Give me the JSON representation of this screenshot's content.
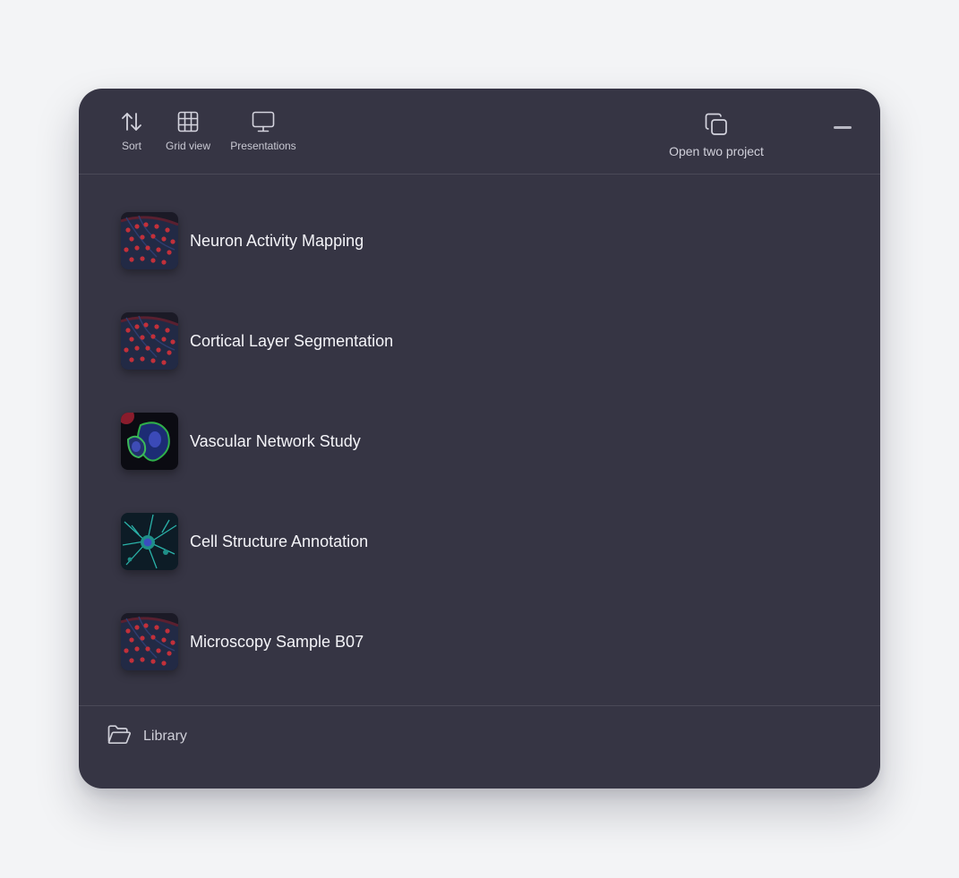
{
  "toolbar": {
    "sort": {
      "label": "Sort",
      "icon": "sort-arrows-icon"
    },
    "grid_view": {
      "label": "Grid view",
      "icon": "grid-icon"
    },
    "presentations": {
      "label": "Presentations",
      "icon": "monitor-icon"
    },
    "open_two": {
      "label": "Open two project",
      "icon": "copy-icon"
    },
    "minimize": {
      "icon": "minimize-icon"
    }
  },
  "projects": [
    {
      "name": "Neuron Activity Mapping",
      "thumbnail": "tissue-red-cells"
    },
    {
      "name": "Cortical Layer Segmentation",
      "thumbnail": "tissue-red-cells"
    },
    {
      "name": "Vascular Network Study",
      "thumbnail": "cells-blue-green"
    },
    {
      "name": "Cell Structure Annotation",
      "thumbnail": "neuron-cyan"
    },
    {
      "name": "Microscopy Sample B07",
      "thumbnail": "tissue-red-cells"
    }
  ],
  "footer": {
    "library": {
      "label": "Library",
      "icon": "folder-open-icon"
    }
  },
  "colors": {
    "page_background": "#f3f4f6",
    "panel_background": "#363544",
    "divider": "#4a4957",
    "text_primary": "#f4f4f8",
    "text_secondary": "#cfcfd8"
  }
}
